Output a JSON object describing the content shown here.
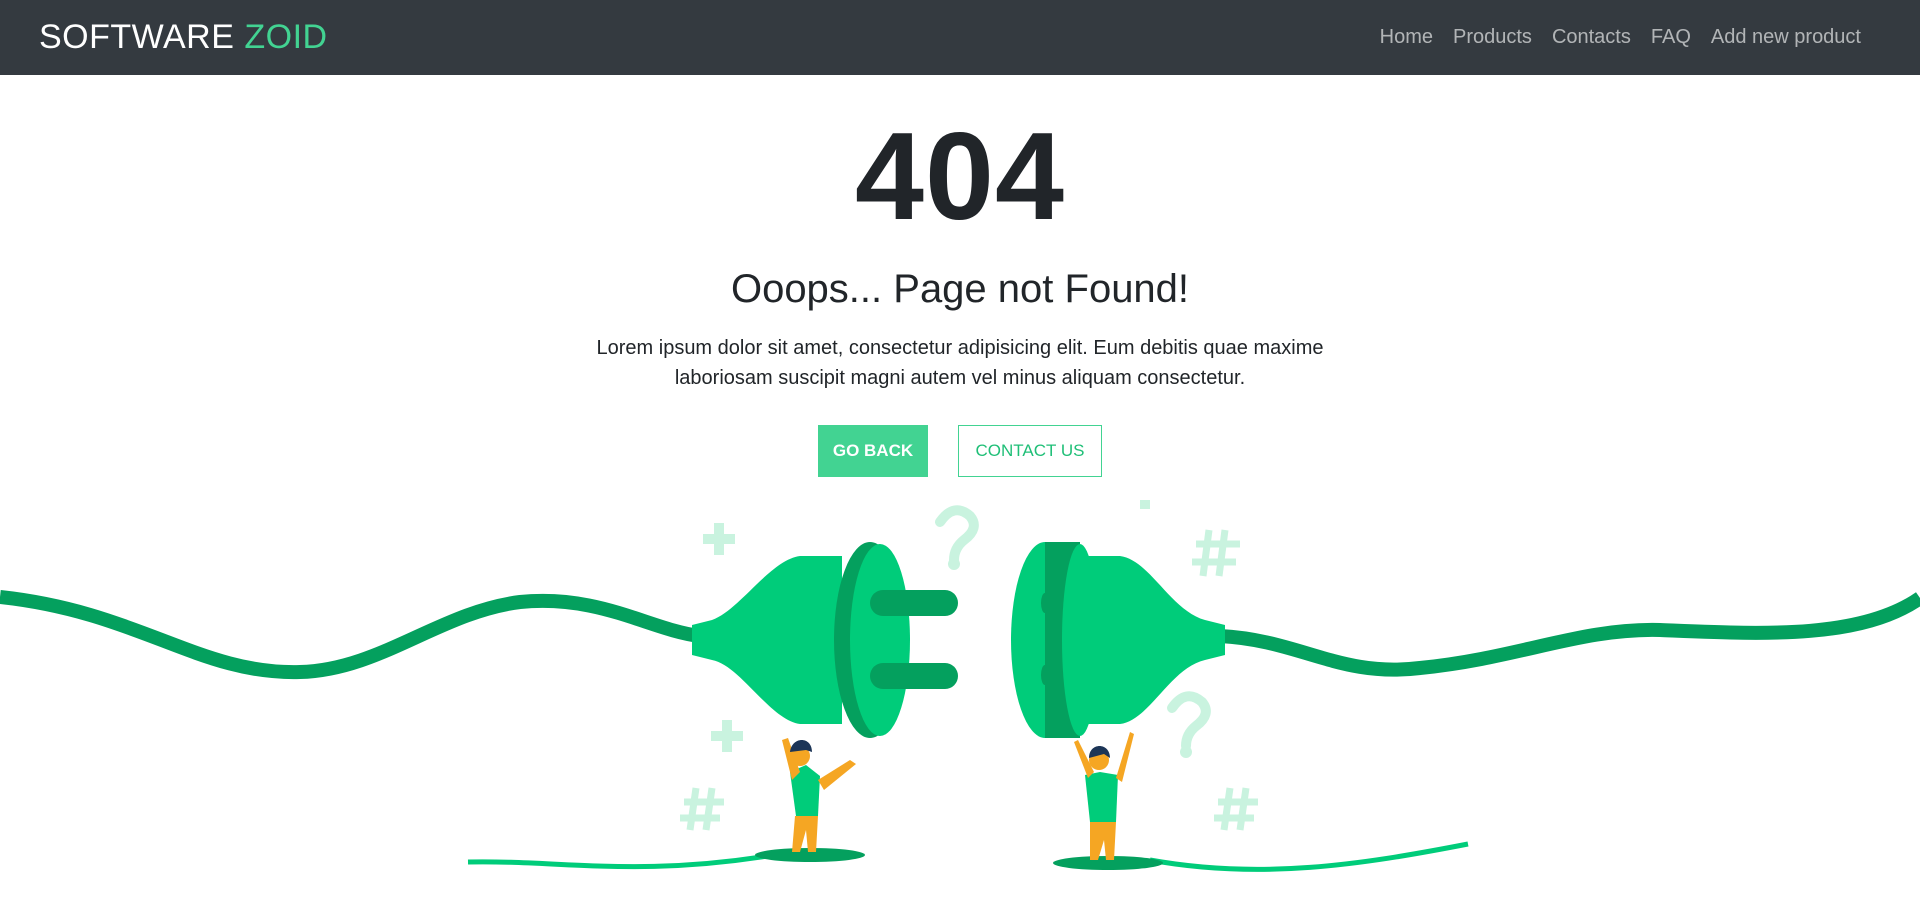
{
  "header": {
    "brand_main": "SOFTWARE ",
    "brand_accent": "ZOID",
    "nav": [
      {
        "label": "Home"
      },
      {
        "label": "Products"
      },
      {
        "label": "Contacts"
      },
      {
        "label": "FAQ"
      },
      {
        "label": "Add new product"
      }
    ]
  },
  "error": {
    "code": "404",
    "title": "Ooops... Page not Found!",
    "description": "Lorem ipsum dolor sit amet, consectetur adipisicing elit. Eum debitis quae maxime laboriosam suscipit magni autem vel minus aliquam consectetur."
  },
  "actions": {
    "go_back": "GO BACK",
    "contact_us": "CONTACT US"
  },
  "colors": {
    "navbar_bg": "#343a40",
    "accent": "#42d392",
    "cable_dark": "#04a05e",
    "plug_light": "#00cc7a",
    "pants": "#f5a623",
    "decoration": "#c9f3df"
  },
  "illustration": {
    "icons": [
      "unplugged-cable-icon",
      "plus-sign-icon",
      "question-mark-icon",
      "hash-sign-icon",
      "person-icon"
    ]
  }
}
